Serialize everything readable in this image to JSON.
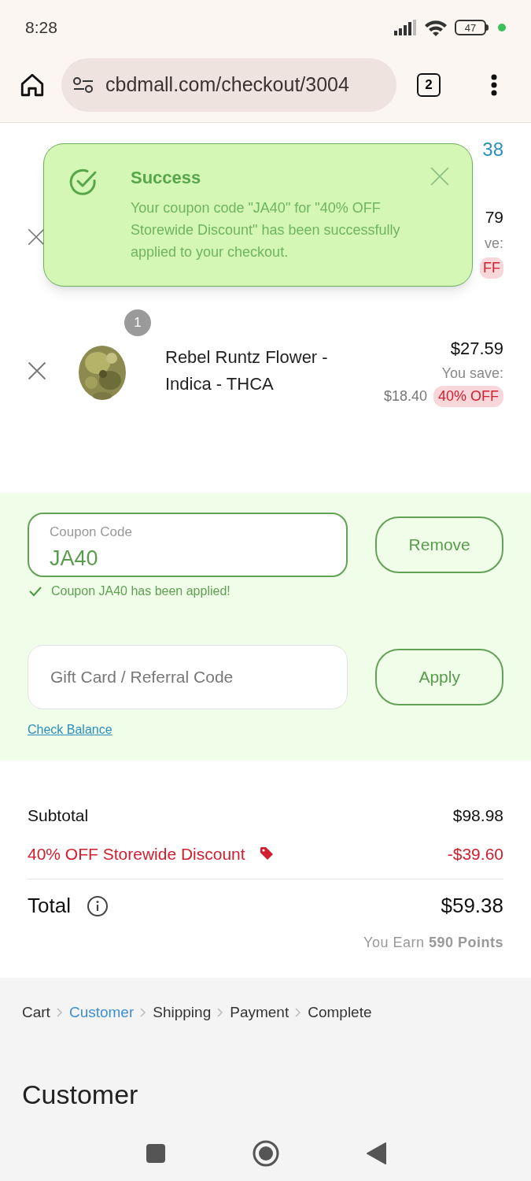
{
  "status_bar": {
    "time": "8:28",
    "battery": "47"
  },
  "browser": {
    "url": "cbdmall.com/checkout/3004",
    "tab_count": "2"
  },
  "partial_header": {
    "phone_fragment": "38"
  },
  "items": [
    {
      "kind": "partial",
      "price": "79",
      "save_label": "ve:",
      "badge": "FF"
    },
    {
      "kind": "full",
      "quantity": "1",
      "name": "Rebel Runtz Flower - Indica - THCA",
      "price": "$27.59",
      "save_label": "You save:",
      "saved": "$18.40",
      "badge": "40% OFF"
    }
  ],
  "toast": {
    "title": "Success",
    "message": "Your coupon code \"JA40\" for \"40% OFF Storewide Discount\" has been successfully applied to your checkout."
  },
  "coupon": {
    "label": "Coupon Code",
    "value": "JA40",
    "button": "Remove",
    "applied": true,
    "note": "Coupon JA40 has been applied!"
  },
  "gift_card": {
    "placeholder": "Gift Card / Referral Code",
    "button": "Apply",
    "link": "Check Balance"
  },
  "totals": {
    "subtotal_label": "Subtotal",
    "subtotal": "$98.98",
    "discount_label": "40% OFF Storewide Discount",
    "discount": "-$39.60",
    "total_label": "Total",
    "total": "$59.38",
    "earn": "You Earn **590 Points**"
  },
  "breadcrumb": [
    {
      "label": "Cart",
      "selected": false
    },
    {
      "label": "Customer",
      "selected": true
    },
    {
      "label": "Shipping",
      "selected": false
    },
    {
      "label": "Payment",
      "selected": false
    },
    {
      "label": "Complete",
      "selected": false
    }
  ],
  "section_title": "Customer"
}
